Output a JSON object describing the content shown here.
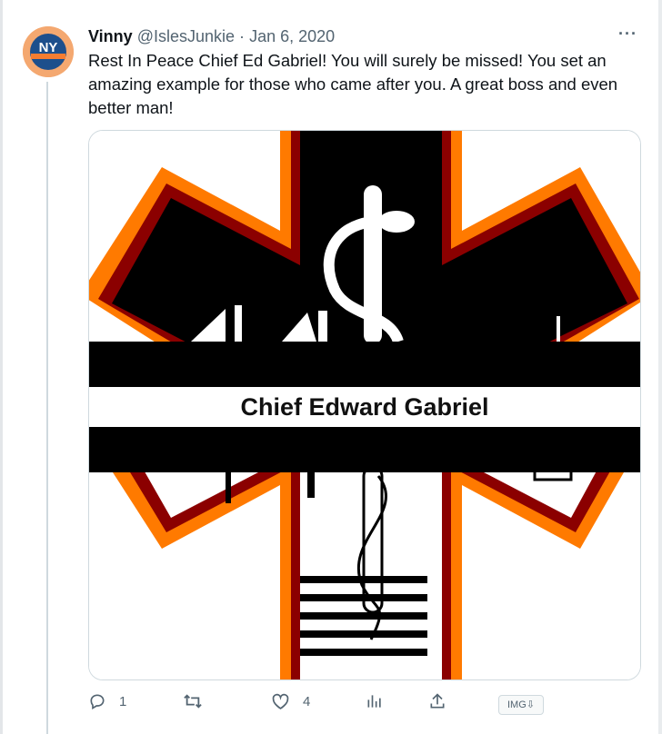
{
  "tweet": {
    "author_name": "Vinny",
    "author_handle": "@IslesJunkie",
    "separator": "·",
    "date": "Jan 6, 2020",
    "more_label": "···",
    "text": "Rest In Peace  Chief Ed Gabriel! You will surely be missed! You set an amazing example for those who came after you. A great boss and even better man!",
    "avatar_text": "NY",
    "image": {
      "caption": "Chief Edward Gabriel",
      "colors": {
        "outer": "#ff7a00",
        "mid": "#8b0000",
        "fill_top": "#000000",
        "fill_bottom": "#ffffff",
        "band": "#000000"
      }
    }
  },
  "actions": {
    "reply": {
      "icon": "reply-icon",
      "count": "1"
    },
    "retweet": {
      "icon": "retweet-icon",
      "count": ""
    },
    "like": {
      "icon": "heart-icon",
      "count": "4"
    },
    "views": {
      "icon": "analytics-icon",
      "count": ""
    },
    "share": {
      "icon": "share-icon",
      "count": ""
    }
  },
  "extension_badge": "IMG⇩"
}
